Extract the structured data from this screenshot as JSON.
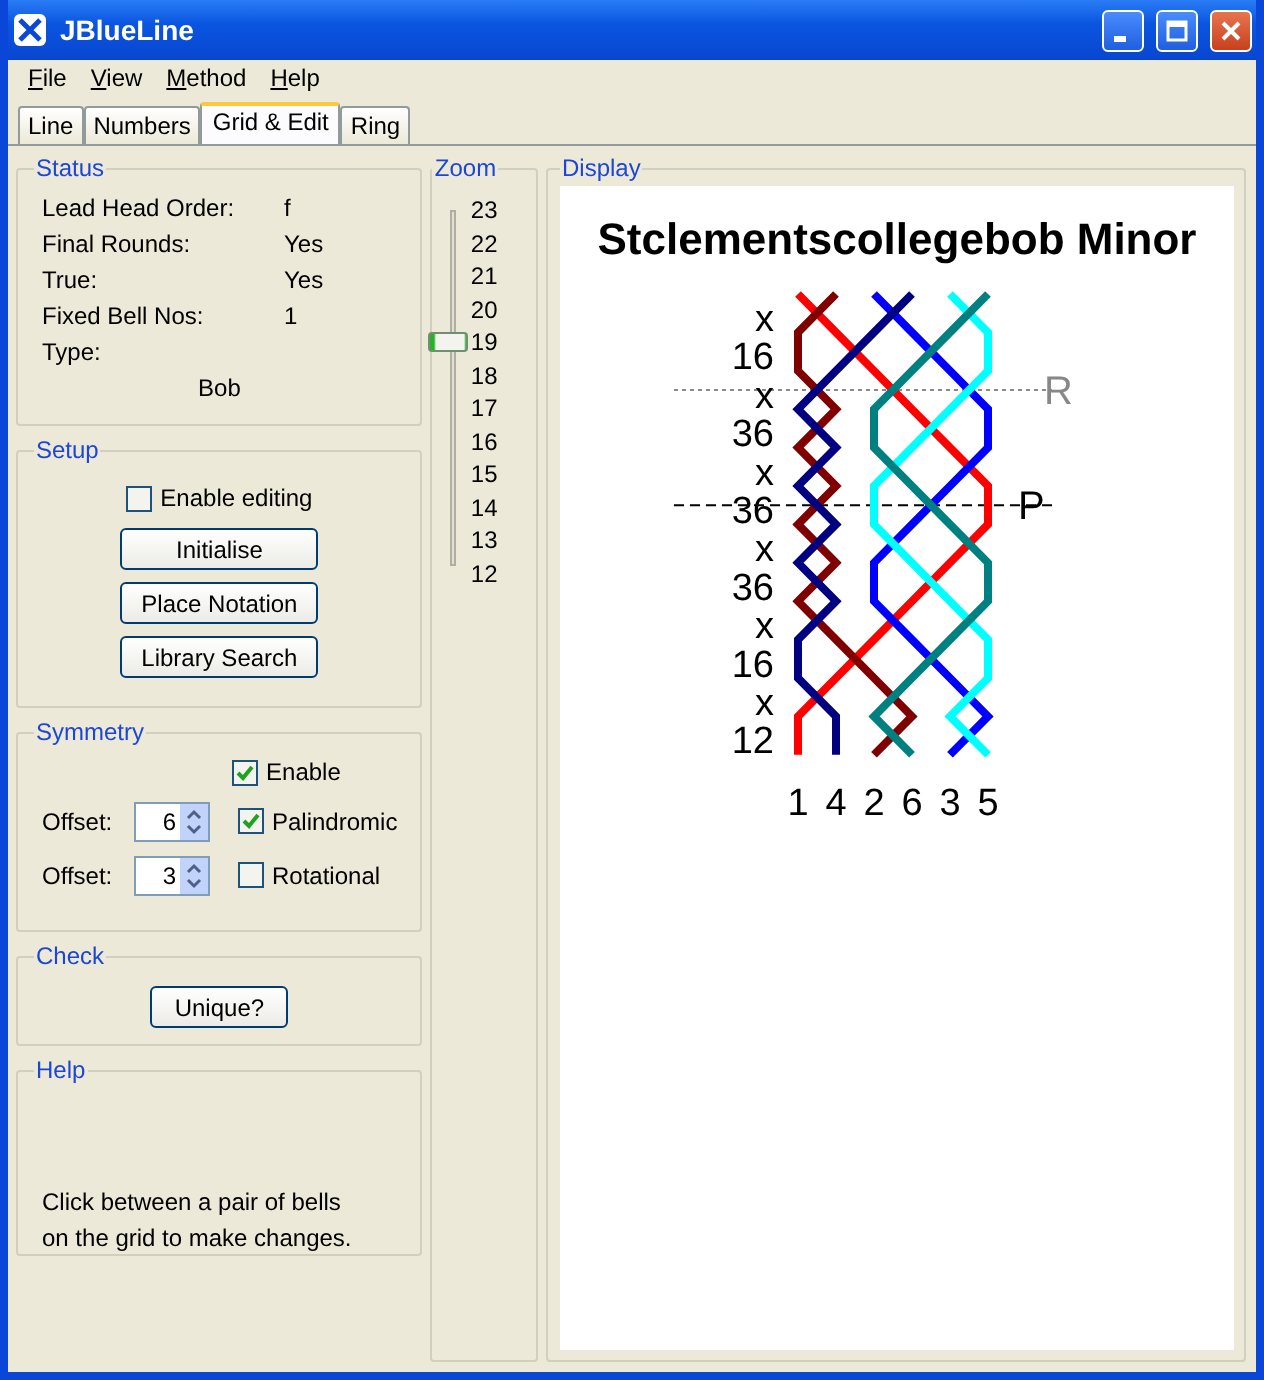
{
  "window": {
    "title": "JBlueLine"
  },
  "menu": [
    "File",
    "View",
    "Method",
    "Help"
  ],
  "tabs": [
    {
      "label": "Line",
      "selected": false
    },
    {
      "label": "Numbers",
      "selected": false
    },
    {
      "label": "Grid & Edit",
      "selected": true
    },
    {
      "label": "Ring",
      "selected": false
    }
  ],
  "status": {
    "title": "Status",
    "rows": [
      {
        "label": "Lead Head Order:",
        "value": "f"
      },
      {
        "label": "Final Rounds:",
        "value": "Yes"
      },
      {
        "label": "True:",
        "value": "Yes"
      },
      {
        "label": "Fixed Bell Nos:",
        "value": "1"
      }
    ],
    "type": {
      "label": "Type:",
      "value": "Bob"
    }
  },
  "setup": {
    "title": "Setup",
    "enable_editing": {
      "label": "Enable editing",
      "checked": false
    },
    "buttons": [
      "Initialise",
      "Place Notation",
      "Library Search"
    ]
  },
  "symmetry": {
    "title": "Symmetry",
    "enable": {
      "label": "Enable",
      "checked": true
    },
    "rows": [
      {
        "label": "Offset:",
        "value": "6",
        "option": {
          "label": "Palindromic",
          "checked": true
        }
      },
      {
        "label": "Offset:",
        "value": "3",
        "option": {
          "label": "Rotational",
          "checked": false
        }
      }
    ]
  },
  "check": {
    "title": "Check",
    "button": "Unique?"
  },
  "help": {
    "title": "Help",
    "lines": [
      "Click between a pair of bells",
      "on the grid to make changes."
    ]
  },
  "zoom": {
    "title": "Zoom",
    "ticks": [
      "23",
      "22",
      "21",
      "20",
      "19",
      "18",
      "17",
      "16",
      "15",
      "14",
      "13",
      "12"
    ],
    "level": 0.636
  },
  "display": {
    "title": "Display",
    "method_title": "Stclementscollegebob Minor",
    "bells": [
      {
        "color": "#ff0000"
      },
      {
        "color": "#800000"
      },
      {
        "color": "#0000ff"
      },
      {
        "color": "#000080"
      },
      {
        "color": "#00ffff"
      },
      {
        "color": "#008080"
      }
    ],
    "notation": [
      {
        "text": "x"
      },
      {
        "text": "16"
      },
      {
        "text": "x",
        "marker": {
          "label": "R",
          "kind": "rounds"
        }
      },
      {
        "text": "36"
      },
      {
        "text": "x"
      },
      {
        "text": "36",
        "marker": {
          "label": "P",
          "kind": "plain"
        }
      },
      {
        "text": "x"
      },
      {
        "text": "36"
      },
      {
        "text": "x"
      },
      {
        "text": "16"
      },
      {
        "text": "x"
      },
      {
        "text": "12"
      }
    ],
    "final_row": [
      "1",
      "4",
      "2",
      "6",
      "3",
      "5"
    ]
  }
}
